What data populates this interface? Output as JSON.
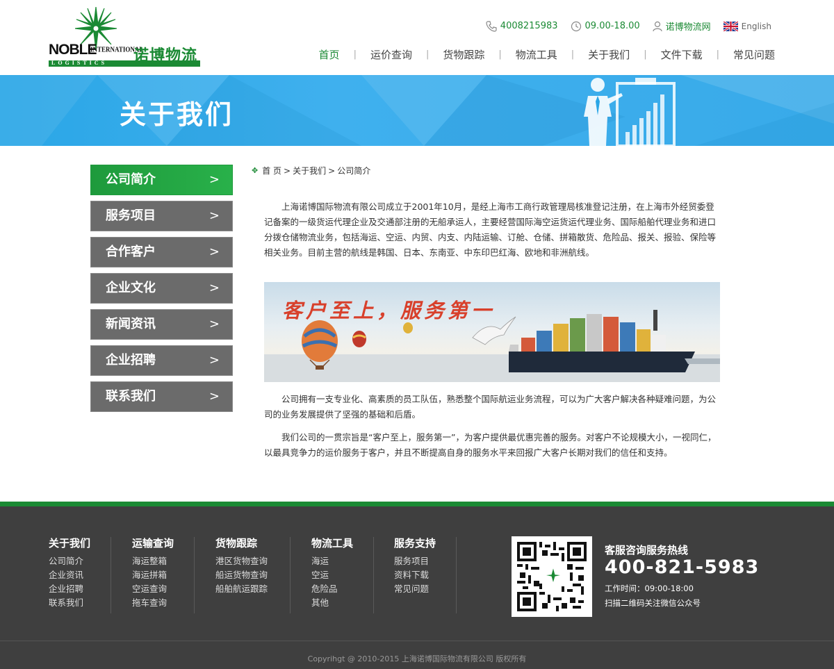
{
  "brand": {
    "logo_en": "NOBLE",
    "logo_intl": "INTERNATIONAL",
    "logo_logistics": "LOGISTICS",
    "logo_cn": "诺博物流",
    "green": "#1b8a34",
    "blue": "#35aceb"
  },
  "topbar": {
    "phone": "4008215983",
    "hours": "09.00-18.00",
    "site": "诺博物流网",
    "lang": "English"
  },
  "nav": [
    "首页",
    "运价查询",
    "货物跟踪",
    "物流工具",
    "关于我们",
    "文件下载",
    "常见问题"
  ],
  "banner": {
    "title": "关于我们"
  },
  "sidebar": [
    "公司简介",
    "服务项目",
    "合作客户",
    "企业文化",
    "新闻资讯",
    "企业招聘",
    "联系我们"
  ],
  "breadcrumb": {
    "home": "首 页",
    "section": "关于我们",
    "current": "公司简介"
  },
  "content": {
    "p1": "上海诺博国际物流有限公司成立于2001年10月，是经上海市工商行政管理局核准登记注册，在上海市外经贸委登记备案的一级货运代理企业及交通部注册的无船承运人，主要经营国际海空运货运代理业务、国际船舶代理业务和进口分拨仓储物流业务，包括海运、空运、内贸、内支、内陆运输、订舱、仓储、拼箱散货、危险品、报关、报验、保险等相关业务。目前主营的航线是韩国、日本、东南亚、中东印巴红海、欧地和非洲航线。",
    "slogan": "客户至上，服务第一",
    "p2": "公司拥有一支专业化、高素质的员工队伍，熟悉整个国际航运业务流程，可以为广大客户解决各种疑难问题，为公司的业务发展提供了坚强的基础和后盾。",
    "p3": "我们公司的一贯宗旨是“客户至上，服务第一”，为客户提供最优惠完善的服务。对客户不论规模大小，一视同仁，以最具竞争力的运价服务于客户，并且不断提高自身的服务水平来回报广大客户长期对我们的信任和支持。"
  },
  "footer": {
    "columns": [
      {
        "title": "关于我们",
        "links": [
          "公司简介",
          "企业资讯",
          "企业招聘",
          "联系我们"
        ]
      },
      {
        "title": "运输查询",
        "links": [
          "海运整箱",
          "海运拼箱",
          "空运查询",
          "拖车查询"
        ]
      },
      {
        "title": "货物跟踪",
        "links": [
          "港区货物查询",
          "船运货物查询",
          "船舶航运跟踪"
        ]
      },
      {
        "title": "物流工具",
        "links": [
          "海运",
          "空运",
          "危险品",
          "其他"
        ]
      },
      {
        "title": "服务支持",
        "links": [
          "服务项目",
          "资料下载",
          "常见问题"
        ]
      }
    ],
    "hotline_label": "客服咨询服务热线",
    "hotline": "400-821-5983",
    "work_time": "工作时间：09:00-18:00",
    "qr_tip": "扫描二维码关注微信公众号",
    "copyright": "Copyrihgt @ 2010-2015 上海诺博国际物流有限公司 版权所有"
  }
}
